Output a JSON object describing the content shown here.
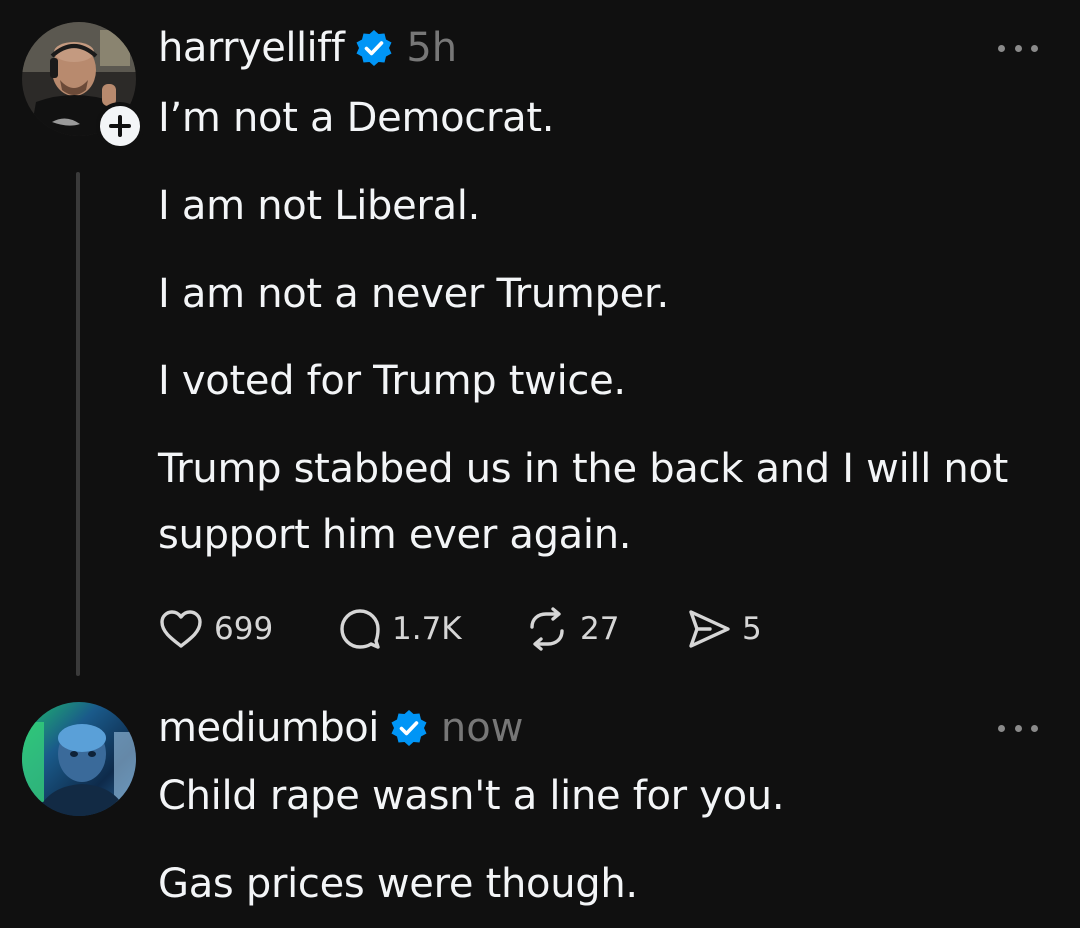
{
  "posts": [
    {
      "username": "harryelliff",
      "time": "5h",
      "avatar_icon": "user-photo-avatar",
      "verified_icon": "verified-badge-icon",
      "follow_label": "+",
      "text": [
        "I’m not a Democrat.",
        "I am not Liberal.",
        "I am not a never Trumper.",
        "I voted for Trump twice.",
        "Trump stabbed us in the back and I will not",
        "support him ever again."
      ],
      "actions": {
        "likes": "699",
        "replies": "1.7K",
        "reposts": "27",
        "shares": "5"
      }
    },
    {
      "username": "mediumboi",
      "time": "now",
      "avatar_icon": "user-photo-avatar",
      "verified_icon": "verified-badge-icon",
      "text": [
        "Child rape wasn't a line for you.",
        "Gas prices were though."
      ]
    }
  ],
  "colors": {
    "background": "#101010",
    "text": "#f3f5f7",
    "muted": "#777777",
    "verified": "#0095f6",
    "thread_line": "#3a3a3a"
  }
}
